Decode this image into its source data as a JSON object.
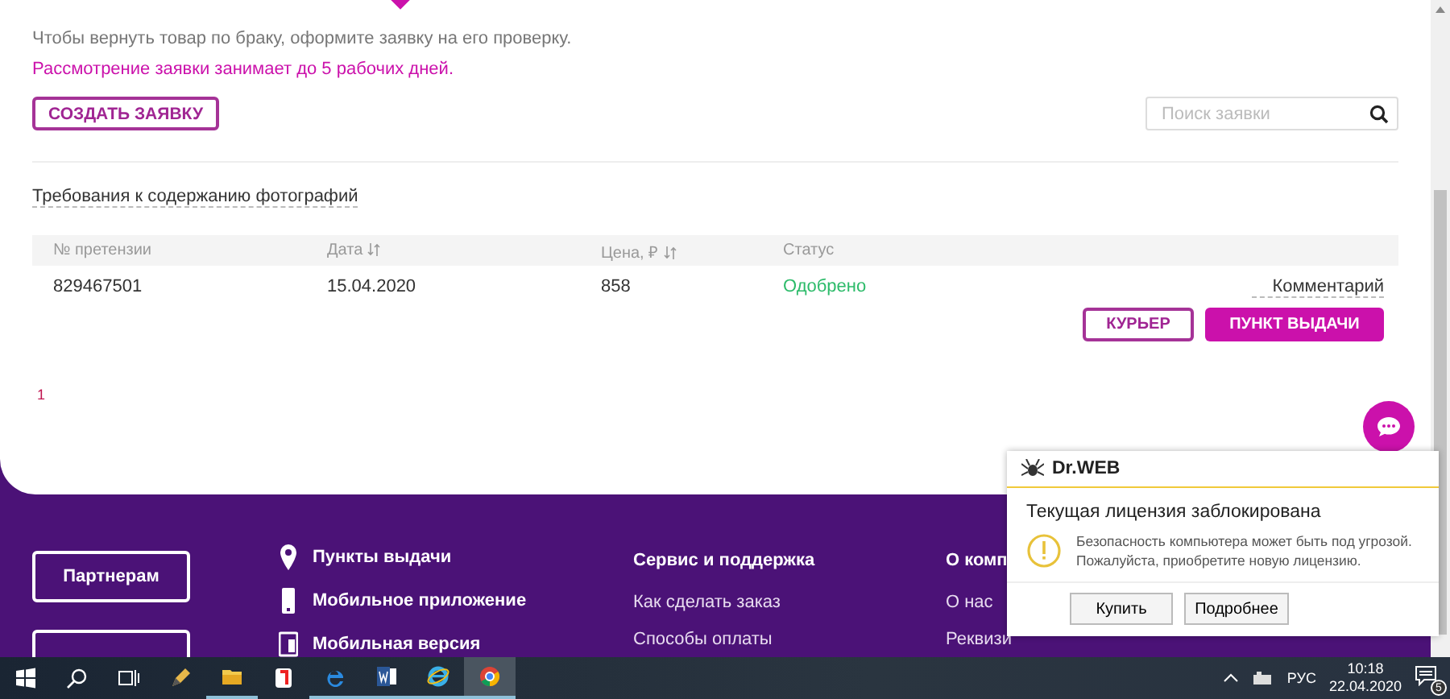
{
  "intro": {
    "text": "Чтобы вернуть товар по браку, оформите заявку на его проверку.",
    "note": "Рассмотрение заявки занимает до 5 рабочих дней."
  },
  "create_button": "СОЗДАТЬ ЗАЯВКУ",
  "search": {
    "placeholder": "Поиск заявки"
  },
  "photo_requirements_link": "Требования к содержанию фотографий",
  "table": {
    "columns": [
      {
        "label": "№ претензии",
        "sortable": false
      },
      {
        "label": "Дата",
        "sortable": true
      },
      {
        "label": "Цена, ₽",
        "sortable": true
      },
      {
        "label": "Статус",
        "sortable": false
      }
    ],
    "rows": [
      {
        "cells": [
          "829467501",
          "15.04.2020",
          "858"
        ],
        "status": "Одобрено",
        "comment_link": "Комментарий",
        "actions": [
          {
            "label": "КУРЬЕР",
            "kind": "outline"
          },
          {
            "label": "ПУНКТ ВЫДАЧИ",
            "kind": "filled"
          }
        ]
      }
    ]
  },
  "pagination": [
    {
      "label": "1",
      "selected": true
    }
  ],
  "footer": {
    "buttons": [
      "Партнерам"
    ],
    "features": [
      {
        "label": "Пункты выдачи",
        "kind": "pin"
      },
      {
        "label": "Мобильное приложение",
        "kind": "phone"
      },
      {
        "label": "Мобильная версия",
        "kind": "tablet"
      }
    ],
    "columns": [
      {
        "heading": "Сервис и поддержка",
        "links": [
          "Как сделать заказ",
          "Способы оплаты"
        ]
      },
      {
        "heading": "О комп",
        "links": [
          "О нас",
          "Реквизи"
        ]
      }
    ]
  },
  "notification": {
    "brand": "Dr.WEB",
    "title": "Текущая лицензия заблокирована",
    "message": "Безопасность компьютера может быть под угрозой. Пожалуйста, приобретите новую лицензию.",
    "buttons": [
      "Купить",
      "Подробнее"
    ]
  },
  "taskbar": {
    "apps": [
      {
        "kind": "pencil",
        "running": false,
        "selected": false
      },
      {
        "kind": "folder",
        "running": true,
        "selected": false
      },
      {
        "kind": "yandex",
        "running": false,
        "selected": false
      },
      {
        "kind": "edge",
        "running": true,
        "selected": false
      },
      {
        "kind": "word",
        "running": true,
        "selected": false
      },
      {
        "kind": "ie",
        "running": true,
        "selected": false
      },
      {
        "kind": "chrome",
        "running": true,
        "selected": true
      }
    ],
    "language": "РУС",
    "time": "10:18",
    "date": "22.04.2020",
    "notification_count": "5"
  }
}
